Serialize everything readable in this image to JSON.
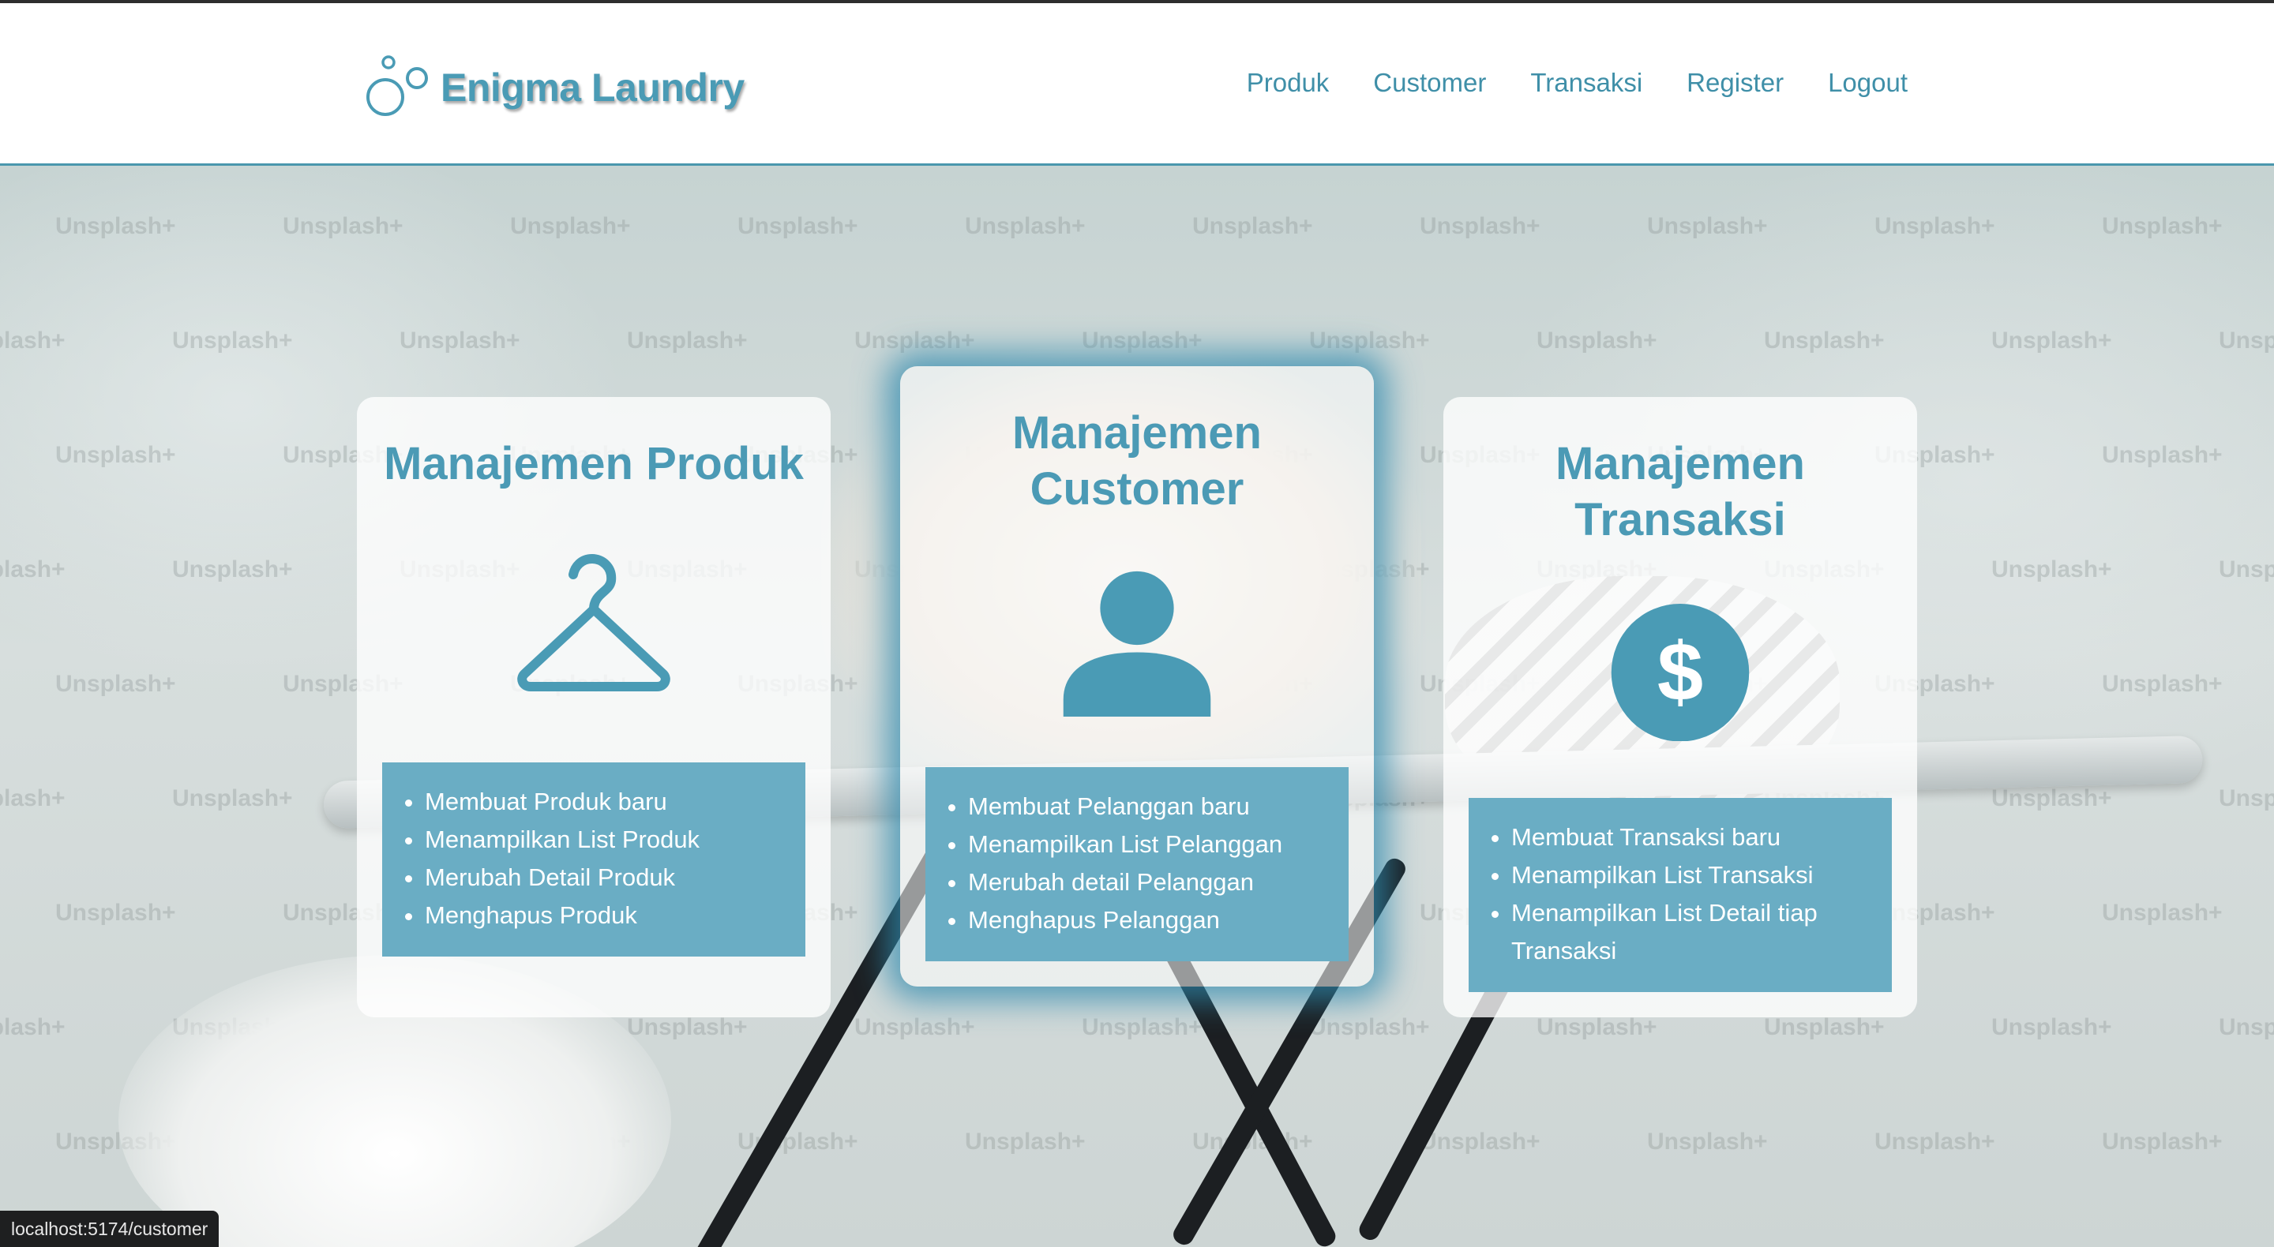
{
  "brand": {
    "name": "Enigma Laundry",
    "logo_icon": "bubbles-icon"
  },
  "nav": {
    "items": [
      "Produk",
      "Customer",
      "Transaksi",
      "Register",
      "Logout"
    ]
  },
  "watermark_text": "Unsplash+",
  "cards": [
    {
      "title": "Manajemen Produk",
      "icon": "hanger-icon",
      "features": [
        "Membuat Produk baru",
        "Menampilkan List Produk",
        "Merubah Detail Produk",
        "Menghapus Produk"
      ]
    },
    {
      "title": "Manajemen Customer",
      "icon": "user-icon",
      "features": [
        "Membuat Pelanggan baru",
        "Menampilkan List Pelanggan",
        "Merubah detail Pelanggan",
        "Menghapus Pelanggan"
      ]
    },
    {
      "title": "Manajemen Transaksi",
      "icon": "dollar-circle-icon",
      "features": [
        "Membuat Transaksi baru",
        "Menampilkan List Transaksi",
        "Menampilkan List Detail tiap Transaksi"
      ]
    }
  ],
  "status_bar": {
    "url": "localhost:5174/customer"
  },
  "colors": {
    "accent": "#4a9bb5",
    "feature_bg": "#6aadc4",
    "glow": "#2f89ad"
  }
}
